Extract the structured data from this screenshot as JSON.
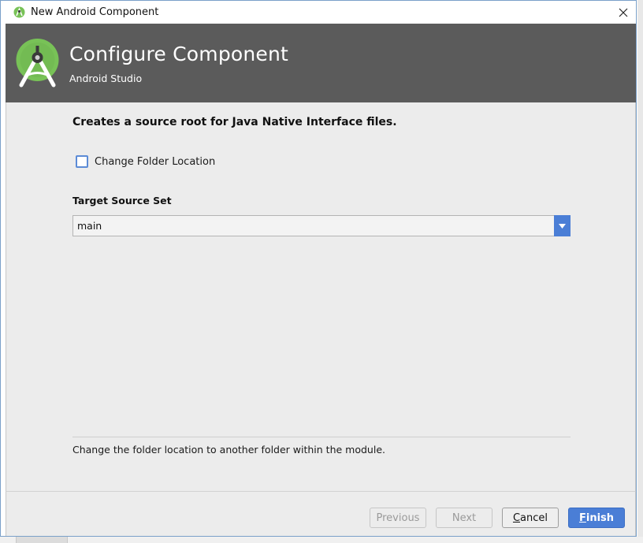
{
  "window": {
    "title": "New Android Component",
    "close_icon": "close-icon"
  },
  "header": {
    "title": "Configure Component",
    "subtitle": "Android Studio",
    "logo_icon": "android-studio-logo-icon",
    "background": "#5b5b5b"
  },
  "content": {
    "description": "Creates a source root for Java Native Interface files.",
    "checkbox": {
      "label": "Change Folder Location",
      "checked": false
    },
    "target_source_set": {
      "label": "Target Source Set",
      "value": "main",
      "dropdown_icon": "chevron-down-icon"
    },
    "help_text": "Change the folder location to another folder within the module."
  },
  "footer": {
    "previous": {
      "first": "",
      "rest": "Previous",
      "enabled": false
    },
    "next": {
      "first": "",
      "rest": "Next",
      "enabled": false
    },
    "cancel": {
      "first": "C",
      "rest": "ancel",
      "enabled": true
    },
    "finish": {
      "first": "F",
      "rest": "inish",
      "enabled": true
    }
  },
  "colors": {
    "accent": "#4a7ed6",
    "panel": "#ececec",
    "logo_green": "#78c257"
  }
}
